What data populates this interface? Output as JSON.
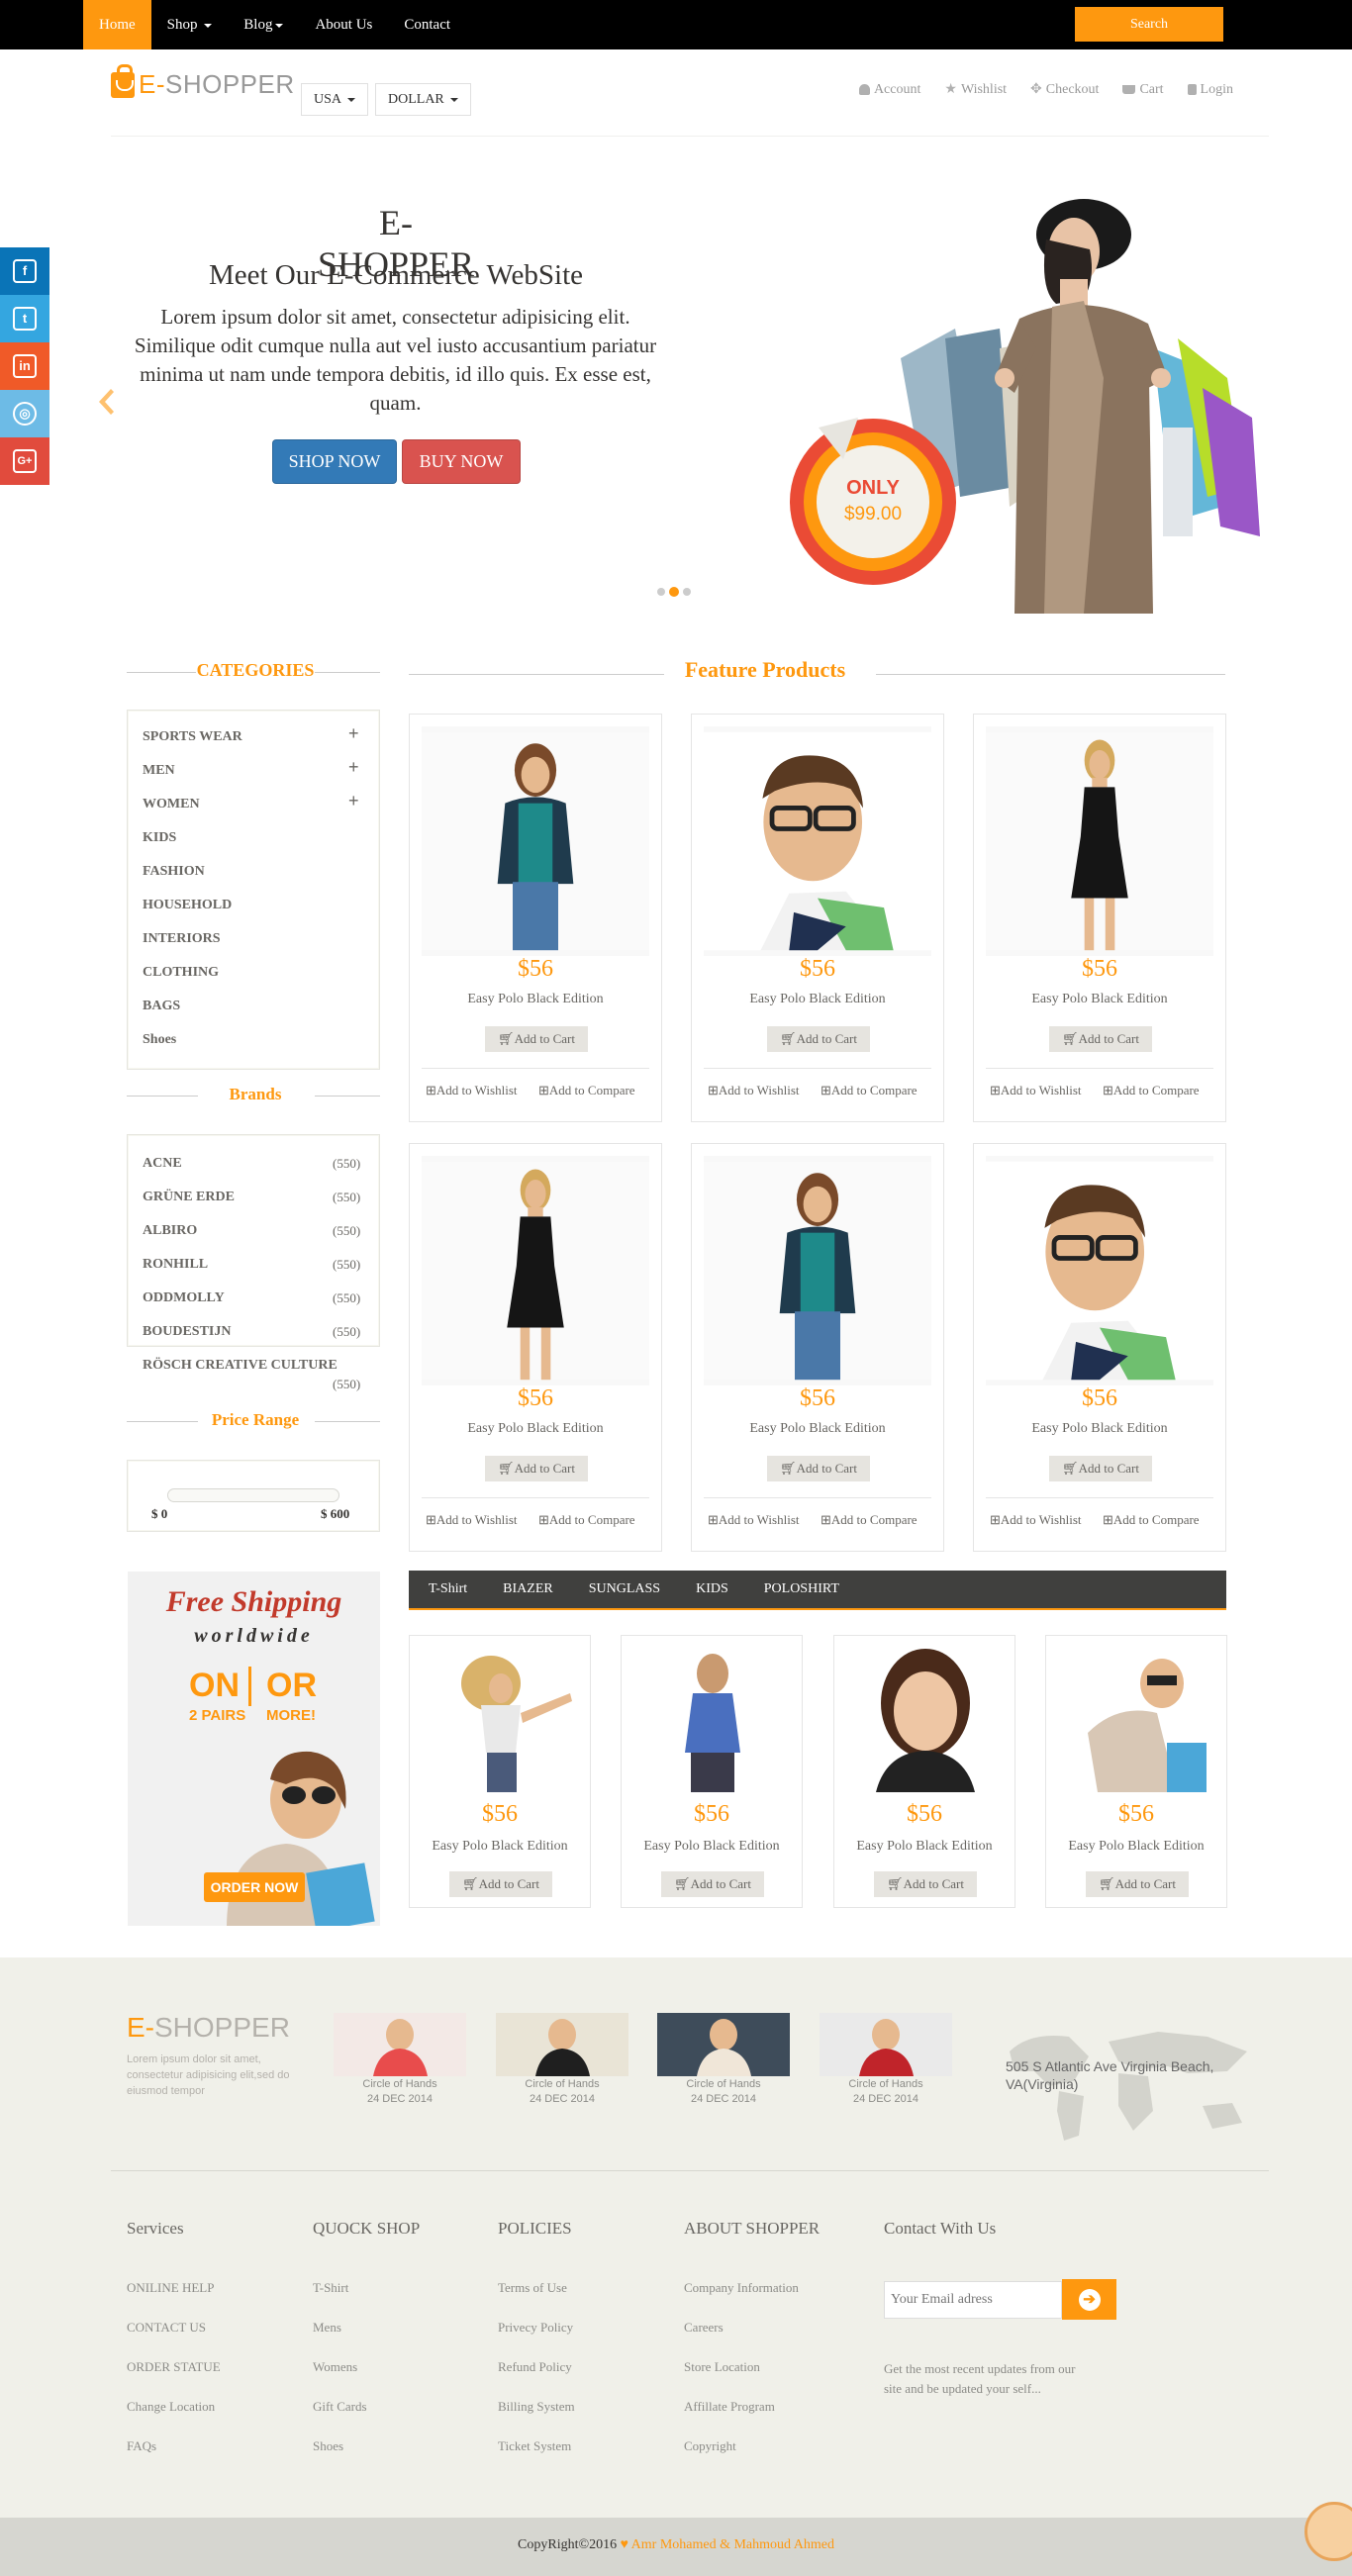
{
  "nav": {
    "items": [
      {
        "label": "Home",
        "active": true,
        "dropdown": false
      },
      {
        "label": "Shop",
        "active": false,
        "dropdown": true
      },
      {
        "label": "Blog",
        "active": false,
        "dropdown": true
      },
      {
        "label": "About Us",
        "active": false,
        "dropdown": false
      },
      {
        "label": "Contact",
        "active": false,
        "dropdown": false
      }
    ],
    "search_label": "Search"
  },
  "header": {
    "logo_brand": "E-",
    "logo_rest": "SHOPPER",
    "country": "USA",
    "currency": "DOLLAR",
    "user_menu": [
      "Account",
      "Wishlist",
      "Checkout",
      "Cart",
      "Login"
    ]
  },
  "social": [
    "facebook-icon",
    "twitter-icon",
    "linkedin-icon",
    "dribbble-icon",
    "google-plus-icon"
  ],
  "slider": {
    "title": "E-SHOPPER",
    "subtitle": "Meet Our E-Commerce WebSite",
    "description": "Lorem ipsum dolor sit amet, consectetur adipisicing elit. Similique odit cumque nulla aut vel iusto accusantium pariatur minima ut nam unde tempora debitis, id illo quis. Ex esse est, quam.",
    "shop_now": "SHOP NOW",
    "buy_now": "BUY NOW",
    "badge_label": "ONLY",
    "badge_price": "$99.00"
  },
  "sidebar": {
    "categories_title": "CATEGORIES",
    "categories": [
      {
        "label": "SPORTS WEAR",
        "expandable": true
      },
      {
        "label": "MEN",
        "expandable": true
      },
      {
        "label": "WOMEN",
        "expandable": true
      },
      {
        "label": "KIDS",
        "expandable": false
      },
      {
        "label": "FASHION",
        "expandable": false
      },
      {
        "label": "HOUSEHOLD",
        "expandable": false
      },
      {
        "label": "INTERIORS",
        "expandable": false
      },
      {
        "label": "CLOTHING",
        "expandable": false
      },
      {
        "label": "BAGS",
        "expandable": false
      },
      {
        "label": "Shoes",
        "expandable": false
      }
    ],
    "brands_title": "Brands",
    "brands": [
      {
        "name": "ACNE",
        "count": "(550)"
      },
      {
        "name": "GRÜNE ERDE",
        "count": "(550)"
      },
      {
        "name": "ALBIRO",
        "count": "(550)"
      },
      {
        "name": "RONHILL",
        "count": "(550)"
      },
      {
        "name": "ODDMOLLY",
        "count": "(550)"
      },
      {
        "name": "BOUDESTIJN",
        "count": "(550)"
      },
      {
        "name": "RÖSCH CREATIVE CULTURE",
        "count": "(550)"
      }
    ],
    "price_title": "Price Range",
    "price_min": "$ 0",
    "price_max": "$ 600",
    "ad": {
      "line1": "Free Shipping",
      "line2": "worldwide",
      "on": "ON",
      "pairs": "2 PAIRS",
      "or": "OR",
      "more": "MORE!",
      "order": "ORDER NOW"
    }
  },
  "features": {
    "title": "Feature Products",
    "products": [
      {
        "price": "$56",
        "name": "Easy Polo Black Edition",
        "add_to_cart": "Add to Cart",
        "wishlist": "Add to Wishlist",
        "compare": "Add to Compare"
      },
      {
        "price": "$56",
        "name": "Easy Polo Black Edition",
        "add_to_cart": "Add to Cart",
        "wishlist": "Add to Wishlist",
        "compare": "Add to Compare"
      },
      {
        "price": "$56",
        "name": "Easy Polo Black Edition",
        "add_to_cart": "Add to Cart",
        "wishlist": "Add to Wishlist",
        "compare": "Add to Compare"
      },
      {
        "price": "$56",
        "name": "Easy Polo Black Edition",
        "add_to_cart": "Add to Cart",
        "wishlist": "Add to Wishlist",
        "compare": "Add to Compare"
      },
      {
        "price": "$56",
        "name": "Easy Polo Black Edition",
        "add_to_cart": "Add to Cart",
        "wishlist": "Add to Wishlist",
        "compare": "Add to Compare"
      },
      {
        "price": "$56",
        "name": "Easy Polo Black Edition",
        "add_to_cart": "Add to Cart",
        "wishlist": "Add to Wishlist",
        "compare": "Add to Compare"
      }
    ]
  },
  "category_tabs": {
    "tabs": [
      "T-Shirt",
      "BIAZER",
      "SUNGLASS",
      "KIDS",
      "POLOSHIRT"
    ],
    "products": [
      {
        "price": "$56",
        "name": "Easy Polo Black Edition",
        "add_to_cart": "Add to Cart"
      },
      {
        "price": "$56",
        "name": "Easy Polo Black Edition",
        "add_to_cart": "Add to Cart"
      },
      {
        "price": "$56",
        "name": "Easy Polo Black Edition",
        "add_to_cart": "Add to Cart"
      },
      {
        "price": "$56",
        "name": "Easy Polo Black Edition",
        "add_to_cart": "Add to Cart"
      }
    ]
  },
  "footer": {
    "brand_e": "E-",
    "brand_rest": "SHOPPER",
    "tagline": "Lorem ipsum dolor sit amet, consectetur adipisicing elit,sed do eiusmod tempor",
    "blog": [
      {
        "caption": "Circle of Hands",
        "date": "24 DEC 2014"
      },
      {
        "caption": "Circle of Hands",
        "date": "24 DEC 2014"
      },
      {
        "caption": "Circle of Hands",
        "date": "24 DEC 2014"
      },
      {
        "caption": "Circle of Hands",
        "date": "24 DEC 2014"
      }
    ],
    "address": "505 S Atlantic Ave Virginia Beach, VA(Virginia)",
    "columns": [
      {
        "title": "Services",
        "items": [
          "ONILINE HELP",
          "CONTACT US",
          "ORDER STATUE",
          "Change Location",
          "FAQs"
        ]
      },
      {
        "title": "QUOCK SHOP",
        "items": [
          "T-Shirt",
          "Mens",
          "Womens",
          "Gift Cards",
          "Shoes"
        ]
      },
      {
        "title": "POLICIES",
        "items": [
          "Terms of Use",
          "Privecy Policy",
          "Refund Policy",
          "Billing System",
          "Ticket System"
        ]
      },
      {
        "title": "ABOUT SHOPPER",
        "items": [
          "Company Information",
          "Careers",
          "Store Location",
          "Affillate Program",
          "Copyright"
        ]
      }
    ],
    "contact_title": "Contact With Us",
    "email_placeholder": "Your Email adress",
    "contact_note": "Get the most recent updates from our site and be updated your self...",
    "copyright": "CopyRight©2016",
    "authors": "Amr Mohamed & Mahmoud Ahmed"
  },
  "colors": {
    "accent": "#fe980f",
    "text": "#696763",
    "dark": "#40403e",
    "footer_bg": "#f0f0e9"
  }
}
